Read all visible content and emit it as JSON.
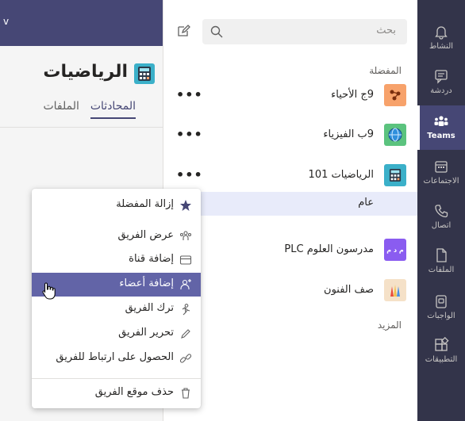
{
  "main": {
    "team_title": "الرياضيات",
    "tabs": [
      {
        "label": "المحادثات",
        "active": true
      },
      {
        "label": "الملفات",
        "active": false
      }
    ],
    "header_color": "#464775"
  },
  "search": {
    "placeholder": "بحث"
  },
  "list": {
    "favorites_label": "المفضلة",
    "more_label": "المزيد",
    "teams": [
      {
        "name": "9ج الأحياء",
        "icon": "biology-icon",
        "color": "#f7a26b"
      },
      {
        "name": "9ب الفيزياء",
        "icon": "globe-icon",
        "color": "#5bc37e"
      },
      {
        "name": "الرياضيات 101",
        "icon": "calculator-icon",
        "color": "#3bb0c9"
      },
      {
        "name": "مدرسون العلوم PLC",
        "icon": "initials-icon",
        "initials": "م د م",
        "color": "#8a5cf0"
      },
      {
        "name": "صف الفنون",
        "icon": "pencils-icon",
        "color": "#f2c14e"
      }
    ],
    "channel": "عام",
    "more_dots": "•••"
  },
  "rail": {
    "items": [
      {
        "label": "النشاط",
        "icon": "bell-icon"
      },
      {
        "label": "دردشة",
        "icon": "chat-icon"
      },
      {
        "label": "Teams",
        "icon": "teams-icon",
        "active": true
      },
      {
        "label": "الاجتماعات",
        "icon": "calendar-icon"
      },
      {
        "label": "اتصال",
        "icon": "phone-icon"
      },
      {
        "label": "الملفات",
        "icon": "file-icon"
      },
      {
        "label": "الواجبات",
        "icon": "assignments-icon"
      },
      {
        "label": "التطبيقات",
        "icon": "apps-icon"
      }
    ],
    "bg": "#33344a",
    "active_bg": "#464775"
  },
  "context_menu": {
    "items": [
      {
        "label": "إزالة المفضلة",
        "icon": "star-icon"
      },
      {
        "label": "عرض الفريق",
        "icon": "team-icon"
      },
      {
        "label": "إضافة قناة",
        "icon": "channel-icon"
      },
      {
        "label": "إضافة أعضاء",
        "icon": "add-member-icon",
        "highlighted": true
      },
      {
        "label": "ترك الفريق",
        "icon": "leave-icon"
      },
      {
        "label": "تحرير الفريق",
        "icon": "pencil-icon"
      },
      {
        "label": "الحصول على ارتباط للفريق",
        "icon": "link-icon"
      },
      {
        "label": "حذف موقع الفريق",
        "icon": "trash-icon"
      }
    ],
    "highlight_color": "#6264a7"
  }
}
